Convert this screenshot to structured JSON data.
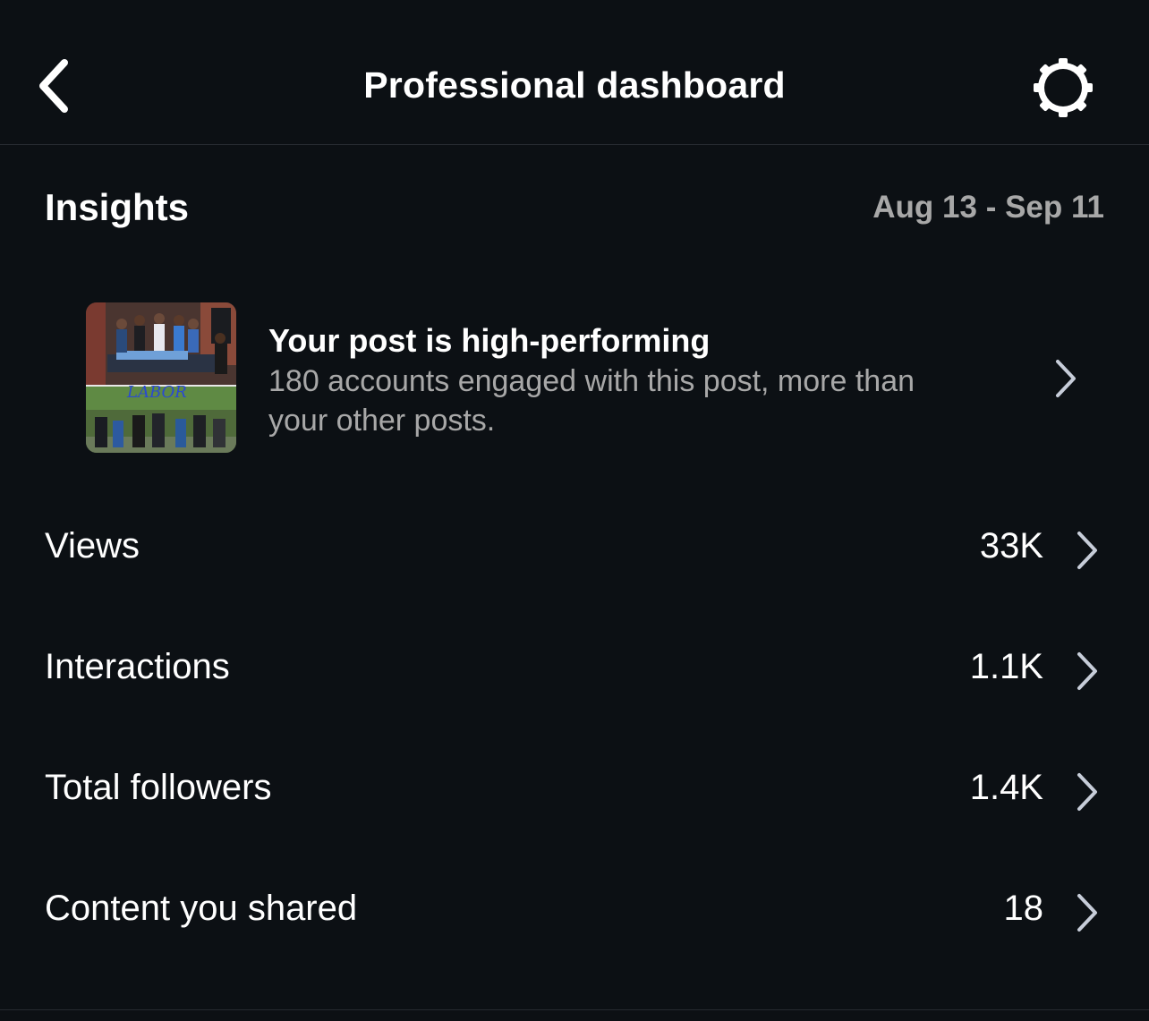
{
  "header": {
    "title": "Professional dashboard",
    "back_icon": "chevron-left-icon",
    "settings_icon": "gear-icon"
  },
  "insights": {
    "title": "Insights",
    "date_range": "Aug 13 - Sep 11"
  },
  "highlight": {
    "title": "Your post is high-performing",
    "description": "180 accounts engaged with this post, more than your other posts.",
    "thumbnail_overlay_text": "LABOR",
    "icon": "chevron-right-icon"
  },
  "metrics": [
    {
      "label": "Views",
      "value": "33K"
    },
    {
      "label": "Interactions",
      "value": "1.1K"
    },
    {
      "label": "Total followers",
      "value": "1.4K"
    },
    {
      "label": "Content you shared",
      "value": "18"
    }
  ],
  "colors": {
    "background": "#0c1014",
    "primary_text": "#ffffff",
    "secondary_text": "#a8a8a8",
    "divider": "#262a30",
    "chevron": "#c7cdd9"
  }
}
